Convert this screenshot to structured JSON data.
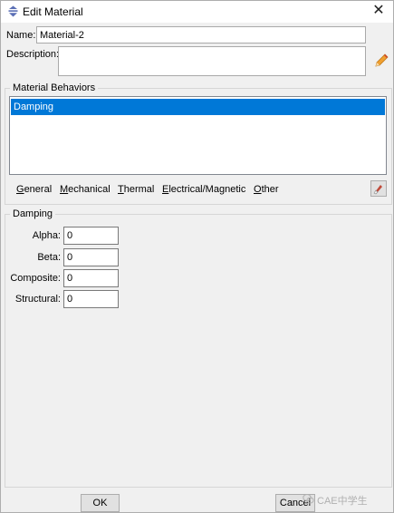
{
  "window": {
    "title": "Edit Material",
    "close_glyph": "✕"
  },
  "name": {
    "label": "Name:",
    "value": "Material-2"
  },
  "description": {
    "label": "Description:",
    "value": ""
  },
  "behaviors": {
    "group_label": "Material Behaviors",
    "items": [
      "Damping"
    ],
    "selected_index": 0
  },
  "menu": [
    {
      "label": "General",
      "mnemonic": "G"
    },
    {
      "label": "Mechanical",
      "mnemonic": "M"
    },
    {
      "label": "Thermal",
      "mnemonic": "T"
    },
    {
      "label": "Electrical/Magnetic",
      "mnemonic": "E"
    },
    {
      "label": "Other",
      "mnemonic": "O"
    }
  ],
  "damping": {
    "group_label": "Damping",
    "fields": [
      {
        "label": "Alpha:",
        "value": "0"
      },
      {
        "label": "Beta:",
        "value": "0"
      },
      {
        "label": "Composite:",
        "value": "0"
      },
      {
        "label": "Structural:",
        "value": "0"
      }
    ]
  },
  "buttons": {
    "ok": "OK",
    "cancel": "Cancel"
  },
  "watermark": "CAE中学生",
  "colors": {
    "selection": "#0078d7",
    "background": "#f0f0f0"
  },
  "icons": [
    "abaqus-material-icon",
    "close-icon",
    "pencil-icon",
    "eraser-icon",
    "wechat-icon"
  ]
}
